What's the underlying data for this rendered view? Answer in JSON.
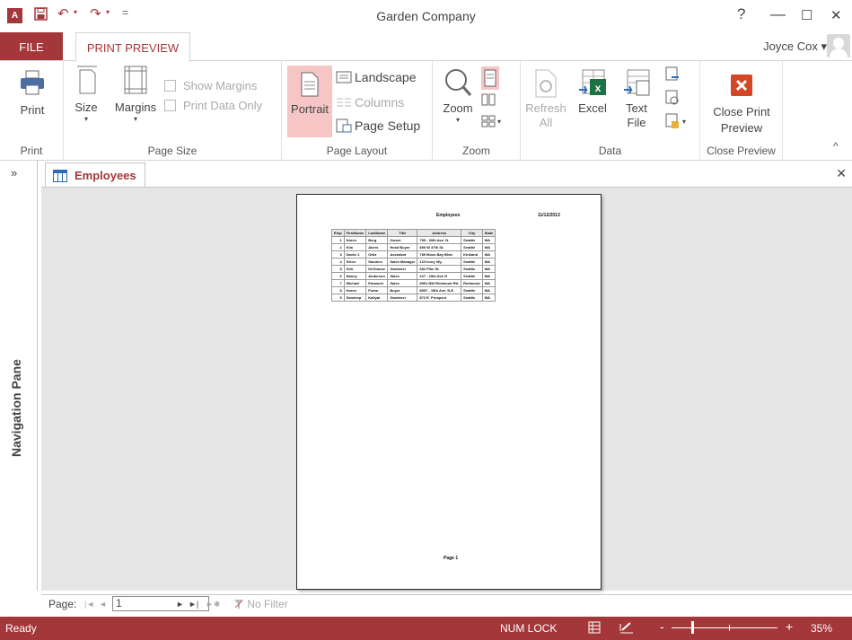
{
  "window": {
    "title": "Garden Company",
    "help": "?",
    "minimize": "—",
    "maximize": "☐",
    "close": "✕"
  },
  "qat": {
    "app_icon": "A",
    "save_icon": "save-icon",
    "undo": "↶",
    "redo": "↷",
    "customize": "="
  },
  "tabs": {
    "file": "FILE",
    "print_preview": "PRINT PREVIEW"
  },
  "user": {
    "name": "Joyce Cox",
    "dropdown": "▾"
  },
  "ribbon": {
    "print": {
      "print_label": "Print",
      "group_label": "Print"
    },
    "page_size": {
      "size_label": "Size",
      "margins_label": "Margins",
      "show_margins": "Show Margins",
      "print_data_only": "Print Data Only",
      "group_label": "Page Size"
    },
    "page_layout": {
      "portrait": "Portrait",
      "landscape": "Landscape",
      "columns": "Columns",
      "page_setup": "Page Setup",
      "group_label": "Page Layout"
    },
    "zoom": {
      "zoom_label": "Zoom",
      "group_label": "Zoom"
    },
    "data": {
      "refresh_1": "Refresh",
      "refresh_2": "All",
      "excel": "Excel",
      "text_1": "Text",
      "text_2": "File",
      "group_label": "Data"
    },
    "close_preview": {
      "close_1": "Close Print",
      "close_2": "Preview",
      "group_label": "Close Preview"
    },
    "collapse": "^"
  },
  "nav": {
    "toggle": "»",
    "label": "Navigation Pane"
  },
  "document": {
    "tab": "Employees",
    "close": "✕",
    "report_title": "Employees",
    "report_date": "11/12/2013",
    "footer": "Page 1",
    "columns": [
      "Emp",
      "FirstName",
      "LastName",
      "Title",
      "Address",
      "City",
      "State"
    ],
    "rows": [
      [
        "1",
        "Karen",
        "Berg",
        "Owner",
        "785 - 30th Ave. N.",
        "Seattle",
        "WA"
      ],
      [
        "2",
        "Kim",
        "Akers",
        "Head Buyer",
        "890 W 37th St.",
        "Seattle",
        "WA"
      ],
      [
        "3",
        "David J.",
        "Ortiz",
        "Assistant",
        "789 Moss Bay Blvd.",
        "Kirkland",
        "WA"
      ],
      [
        "4",
        "Steve",
        "Sanders",
        "Sales Manager",
        "123 Ivory Wy.",
        "Seattle",
        "WA"
      ],
      [
        "5",
        "Kirk",
        "DeGrasse",
        "Gardener",
        "682 Pike St.",
        "Seattle",
        "WA"
      ],
      [
        "6",
        "Nancy",
        "Anderson",
        "Sales",
        "227 - 20th Ave N",
        "Seattle",
        "WA"
      ],
      [
        "7",
        "Michael",
        "Emanuel",
        "Sales",
        "8901 NW Redmond Rd.",
        "Redmond",
        "WA"
      ],
      [
        "8",
        "Karen",
        "Fuma",
        "Buyer",
        "8907 - 15th Ave. N.E.",
        "Seattle",
        "WA"
      ],
      [
        "9",
        "Sandeep",
        "Kaliyal",
        "Gardener",
        "872 E. Prospect",
        "Seattle",
        "WA"
      ]
    ]
  },
  "record_nav": {
    "page_label": "Page:",
    "first": "◄",
    "prev": "◄",
    "page_value": "1",
    "next": "►",
    "last": "►|",
    "new": "►✱",
    "filter": "No Filter"
  },
  "status": {
    "ready": "Ready",
    "num_lock": "NUM LOCK",
    "zoom_minus": "-",
    "zoom_plus": "+",
    "zoom_level": "35%"
  },
  "colors": {
    "accent": "#a4373a",
    "portrait_highlight": "#f6c6c6",
    "excel_green": "#1e7145",
    "close_red": "#d24726"
  }
}
